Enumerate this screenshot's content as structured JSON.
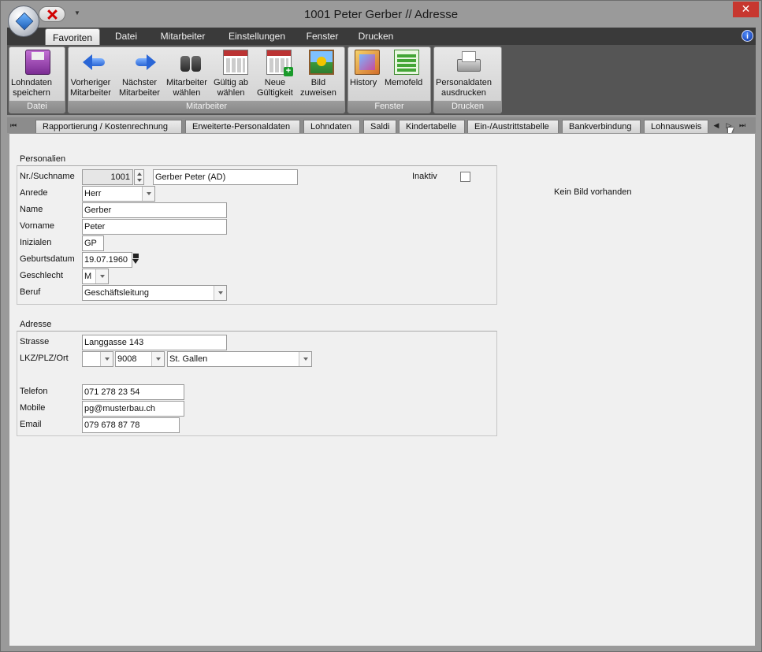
{
  "window": {
    "title": "1001 Peter Gerber // Adresse",
    "close_glyph": "✕"
  },
  "ribbon": {
    "tabs": [
      "Favoriten",
      "Datei",
      "Mitarbeiter",
      "Einstellungen",
      "Fenster",
      "Drucken"
    ],
    "active_tab": "Favoriten",
    "help_glyph": "i",
    "groups": [
      {
        "label": "Datei",
        "buttons": [
          {
            "label": "Lohndaten\nspeichern",
            "icon": "floppy-disk-icon"
          }
        ]
      },
      {
        "label": "Mitarbeiter",
        "buttons": [
          {
            "label": "Vorheriger\nMitarbeiter",
            "icon": "arrow-left-icon"
          },
          {
            "label": "Nächster\nMitarbeiter",
            "icon": "arrow-right-icon"
          },
          {
            "label": "Mitarbeiter\nwählen",
            "icon": "binoculars-icon"
          },
          {
            "label": "Gültig ab\nwählen",
            "icon": "calendar-edit-icon"
          },
          {
            "label": "Neue\nGültigkeit",
            "icon": "calendar-add-icon"
          },
          {
            "label": "Bild\nzuweisen",
            "icon": "picture-icon"
          }
        ]
      },
      {
        "label": "Fenster",
        "buttons": [
          {
            "label": "History",
            "icon": "history-icon"
          },
          {
            "label": "Memofeld",
            "icon": "memo-icon"
          }
        ]
      },
      {
        "label": "Drucken",
        "buttons": [
          {
            "label": "Personaldaten\nausdrucken",
            "icon": "printer-icon"
          }
        ]
      }
    ]
  },
  "page_tabs": [
    "Rapportierung / Kostenrechnung",
    "Erweiterte-Personaldaten",
    "Lohndaten",
    "Saldi",
    "Kindertabelle",
    "Ein-/Austrittstabelle",
    "Bankverbindung",
    "Lohnausweis"
  ],
  "tab_nav": {
    "first": "⏮",
    "prev": "◀",
    "next": "▷",
    "last": "⏭"
  },
  "personalien": {
    "title": "Personalien",
    "labels": {
      "nr": "Nr./Suchname",
      "anrede": "Anrede",
      "name": "Name",
      "vorname": "Vorname",
      "initialen": "Inizialen",
      "geburtsdatum": "Geburtsdatum",
      "geschlecht": "Geschlecht",
      "beruf": "Beruf",
      "inaktiv": "Inaktiv"
    },
    "values": {
      "nr": "1001",
      "suchname": "Gerber Peter (AD)",
      "anrede": "Herr",
      "name": "Gerber",
      "vorname": "Peter",
      "initialen": "GP",
      "geburtsdatum": "19.07.1960",
      "geschlecht": "M",
      "beruf": "Geschäftsleitung",
      "inaktiv": false
    }
  },
  "adresse": {
    "title": "Adresse",
    "labels": {
      "strasse": "Strasse",
      "lkz_plz_ort": "LKZ/PLZ/Ort",
      "telefon": "Telefon",
      "mobile": "Mobile",
      "email": "Email"
    },
    "values": {
      "strasse": "Langgasse 143",
      "lkz": "",
      "plz": "9008",
      "ort": "St. Gallen",
      "telefon": "071 278 23 54",
      "mobile": "pg@musterbau.ch",
      "email": "079 678 87 78"
    }
  },
  "image_panel": {
    "placeholder": "Kein Bild vorhanden"
  }
}
